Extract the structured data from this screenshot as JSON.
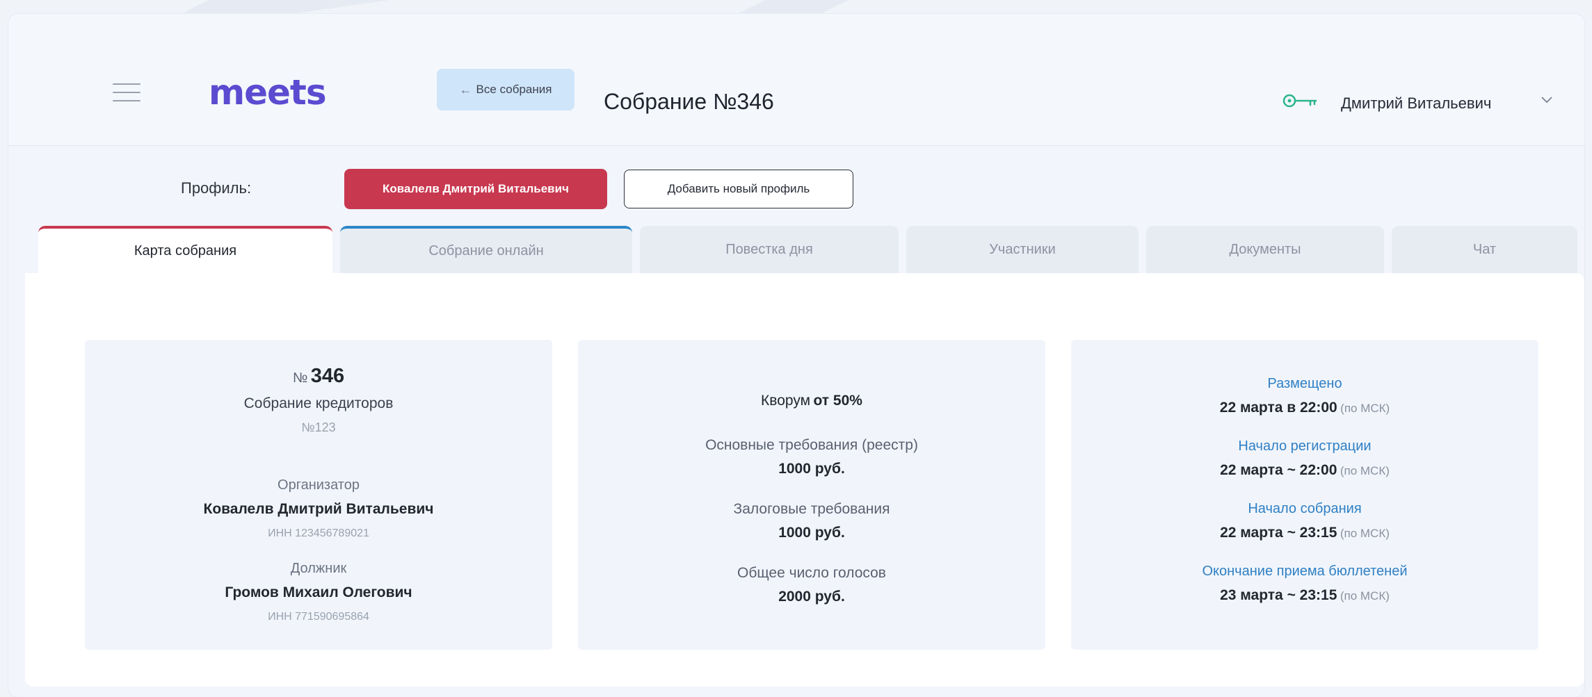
{
  "header": {
    "logo": "meets",
    "back_button": "Все собрания",
    "back_arrow": "←",
    "title": "Собрание №346",
    "user_name": "Дмитрий Витальевич"
  },
  "profile": {
    "label": "Профиль:",
    "active_profile": "Ковалелв Дмитрий Витальевич",
    "add_button": "Добавить новый профиль"
  },
  "tabs": [
    {
      "label": "Карта собрания"
    },
    {
      "label": "Собрание онлайн"
    },
    {
      "label": "Повестка дня"
    },
    {
      "label": "Участники"
    },
    {
      "label": "Документы"
    },
    {
      "label": "Чат"
    }
  ],
  "card1": {
    "number_prefix": "№",
    "number": "346",
    "type": "Собрание кредиторов",
    "ref": "№123",
    "organizer_label": "Организатор",
    "organizer_name": "Ковалелв Дмитрий Витальевич",
    "organizer_inn": "ИНН 123456789021",
    "debtor_label": "Должник",
    "debtor_name": "Громов Михаил Олегович",
    "debtor_inn": "ИНН 771590695864"
  },
  "card2": {
    "quorum_label": "Кворум",
    "quorum_value": "от 50%",
    "main_claims_label": "Основные требования (реестр)",
    "main_claims_value": "1000 руб.",
    "pledge_label": "Залоговые требования",
    "pledge_value": "1000 руб.",
    "votes_label": "Общее число голосов",
    "votes_value": "2000 руб."
  },
  "card3": {
    "msk_note": "(по МСК)",
    "posted_label": "Размещено",
    "posted_date": "22 марта в 22:00",
    "reg_label": "Начало регистрации",
    "reg_date": "22 марта ~ 22:00",
    "start_label": "Начало собрания",
    "start_date": "22 марта ~ 23:15",
    "end_label": "Окончание приема бюллетеней",
    "end_date": "23 марта ~ 23:15"
  },
  "colors": {
    "brand": "#5b4bd0",
    "accent_red": "#c8384f",
    "accent_blue": "#2c87c8",
    "link_blue": "#2f7fc4",
    "back_button_bg": "#cfe5f9"
  },
  "icons": [
    "menu-icon",
    "arrow-left-icon",
    "key-icon",
    "chevron-down-icon"
  ]
}
